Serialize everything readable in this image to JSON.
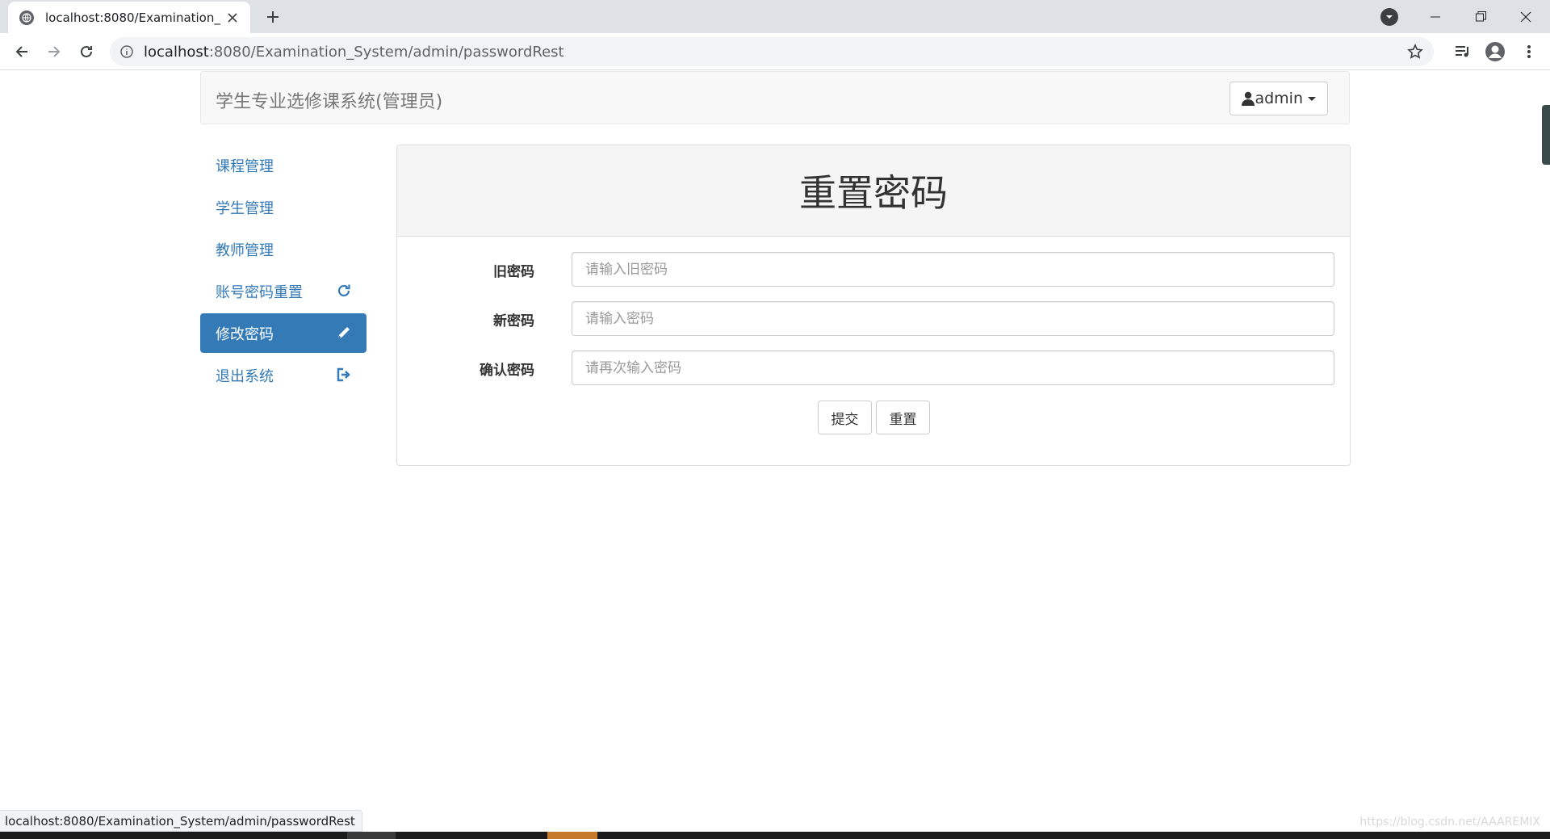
{
  "browser": {
    "tab_title": "localhost:8080/Examination_Sy",
    "url_host": "localhost",
    "url_rest": ":8080/Examination_System/admin/passwordRest",
    "status_url": "localhost:8080/Examination_System/admin/passwordRest"
  },
  "navbar": {
    "brand": "学生专业选修课系统(管理员)",
    "user": "admin"
  },
  "sidebar": {
    "items": [
      {
        "label": "课程管理"
      },
      {
        "label": "学生管理"
      },
      {
        "label": "教师管理"
      },
      {
        "label": "账号密码重置",
        "icon": "refresh-icon"
      },
      {
        "label": "修改密码",
        "icon": "pencil-icon",
        "active": true
      },
      {
        "label": "退出系统",
        "icon": "logout-icon"
      }
    ]
  },
  "panel": {
    "title": "重置密码",
    "fields": [
      {
        "label": "旧密码",
        "placeholder": "请输入旧密码",
        "value": ""
      },
      {
        "label": "新密码",
        "placeholder": "请输入密码",
        "value": ""
      },
      {
        "label": "确认密码",
        "placeholder": "请再次输入密码",
        "value": ""
      }
    ],
    "submit_label": "提交",
    "reset_label": "重置"
  },
  "watermark": "https://blog.csdn.net/AAAREMIX",
  "colors": {
    "primary": "#337ab7",
    "navbar_bg": "#f8f8f8",
    "panel_heading_bg": "#f5f5f5"
  }
}
